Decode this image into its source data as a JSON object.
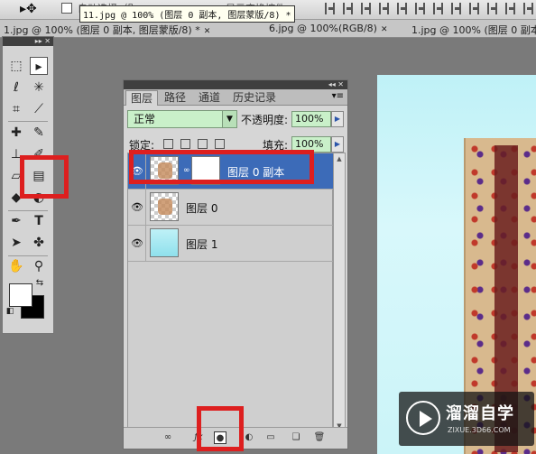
{
  "options_bar": {
    "move_tool": "move-tool-icon",
    "faint_label": "自动选择: 组",
    "faint_label2": "显示变换控件"
  },
  "tooltip": "11.jpg @ 100% (图层 0 副本, 图层蒙版/8) *",
  "doc_tabs": [
    {
      "label": "1.jpg @ 100% (图层 0 副本, 图层蒙版/8) *"
    },
    {
      "label": "6.jpg @ 100%(RGB/8)"
    },
    {
      "label": "1.jpg @ 100% (图层 0 副本"
    }
  ],
  "toolbox": {
    "header_collapse": "▸▸ ✕",
    "tools": [
      "marquee",
      "move",
      "lasso",
      "magic-wand",
      "crop",
      "eyedropper",
      "healing",
      "brush",
      "stamp",
      "gradient",
      "eraser",
      "dodge",
      "pen",
      "type",
      "path-select",
      "shape",
      "hand",
      "zoom"
    ]
  },
  "panel": {
    "collapse": "◂◂ ✕",
    "tabs": [
      "图层",
      "路径",
      "通道",
      "历史记录"
    ],
    "menu_icon": "▾≡",
    "blend_mode": "正常",
    "opacity_label": "不透明度:",
    "opacity_value": "100%",
    "lock_label": "锁定:",
    "fill_label": "填充:",
    "fill_value": "100%",
    "layers": [
      {
        "name": "图层 0 副本",
        "selected": true,
        "has_mask": true
      },
      {
        "name": "图层 0",
        "selected": false,
        "has_mask": false
      },
      {
        "name": "图层 1",
        "selected": false,
        "has_mask": false
      }
    ],
    "bottom_buttons": [
      "link-layers",
      "fx",
      "add-mask",
      "adjustment",
      "group",
      "new-layer",
      "delete"
    ]
  },
  "watermark": {
    "title": "溜溜自学",
    "subtitle": "ZIXUE.3D66.COM"
  },
  "colors": {
    "selected_layer": "#3c6bb8",
    "highlight": "#dd1f1f",
    "field_bg": "#c9f0c9"
  }
}
